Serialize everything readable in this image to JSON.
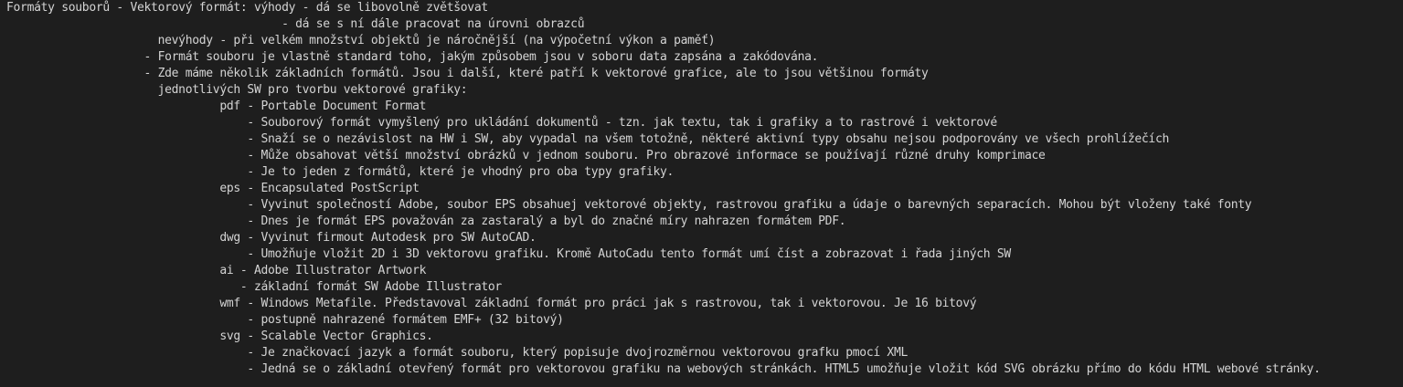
{
  "text_lines": [
    "Formáty souborů - Vektorový formát: výhody - dá se libovolně zvětšovat",
    "                                        - dá se s ní dále pracovat na úrovni obrazců",
    "                      nevýhody - při velkém množství objektů je náročnější (na výpočetní výkon a paměť)",
    "                    - Formát souboru je vlastně standard toho, jakým způsobem jsou v soboru data zapsána a zakódována.",
    "                    - Zde máme několik základních formátů. Jsou i další, které patří k vektorové grafice, ale to jsou většinou formáty",
    "                      jednotlivých SW pro tvorbu vektorové grafiky:",
    "                               pdf - Portable Document Format",
    "                                   - Souborový formát vymyšlený pro ukládání dokumentů - tzn. jak textu, tak i grafiky a to rastrové i vektorové",
    "                                   - Snaží se o nezávislost na HW i SW, aby vypadal na všem totožně, některé aktivní typy obsahu nejsou podporovány ve všech prohlížečích",
    "                                   - Může obsahovat větší množství obrázků v jednom souboru. Pro obrazové informace se používají různé druhy komprimace",
    "                                   - Je to jeden z formátů, které je vhodný pro oba typy grafiky.",
    "                               eps - Encapsulated PostScript",
    "                                   - Vyvinut společností Adobe, soubor EPS obsahuej vektorové objekty, rastrovou grafiku a údaje o barevných separacích. Mohou být vloženy také fonty",
    "                                   - Dnes je formát EPS považován za zastaralý a byl do značné míry nahrazen formátem PDF.",
    "                               dwg - Vyvinut firmout Autodesk pro SW AutoCAD.",
    "                                   - Umožňuje vložit 2D i 3D vektorovu grafiku. Kromě AutoCadu tento formát umí číst a zobrazovat i řada jiných SW",
    "                               ai - Adobe Illustrator Artwork",
    "                                  - základní formát SW Adobe Illustrator",
    "                               wmf - Windows Metafile. Představoval základní formát pro práci jak s rastrovou, tak i vektorovou. Je 16 bitový",
    "                                   - postupně nahrazené formátem EMF+ (32 bitový)",
    "                               svg - Scalable Vector Graphics.",
    "                                   - Je značkovací jazyk a formát souboru, který popisuje dvojrozměrnou vektorovou grafku pmocí XML",
    "                                   - Jedná se o základní otevřený formát pro vektorovou grafiku na webových stránkách. HTML5 umožňuje vložit kód SVG obrázku přímo do kódu HTML webové stránky."
  ],
  "colors": {
    "background": "#1e1e1e",
    "text": "#d4d4d4"
  }
}
